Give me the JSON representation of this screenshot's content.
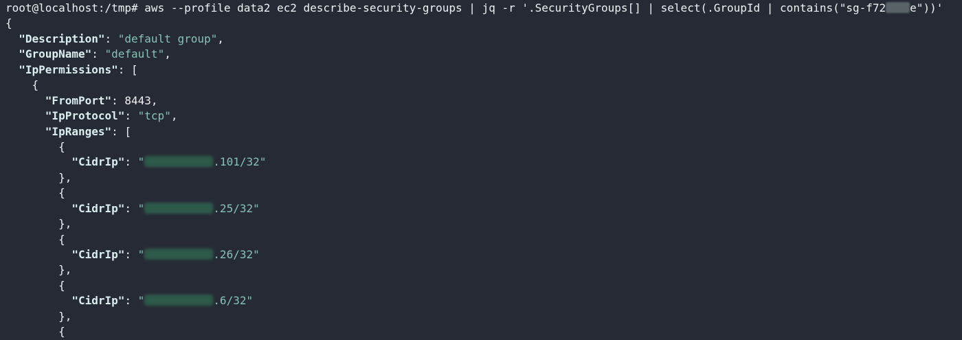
{
  "terminal": {
    "prompt": "root@localhost:/tmp# ",
    "command_before": "aws --profile data2 ec2 describe-security-groups | jq -r '.SecurityGroups[] | select(.GroupId | contains(\"sg-f72",
    "command_after": "e\"))'",
    "output": {
      "open_brace": "{",
      "description_key": "\"Description\"",
      "description_value": "\"default group\"",
      "groupname_key": "\"GroupName\"",
      "groupname_value": "\"default\"",
      "ippermissions_key": "\"IpPermissions\"",
      "fromport_key": "\"FromPort\"",
      "fromport_value": "8443",
      "ipprotocol_key": "\"IpProtocol\"",
      "ipprotocol_value": "\"tcp\"",
      "ipranges_key": "\"IpRanges\"",
      "cidr_key": "\"CidrIp\"",
      "cidr_ranges": [
        ".101/32\"",
        ".25/32\"",
        ".26/32\"",
        ".6/32\""
      ]
    }
  },
  "colors": {
    "background": "#262a35",
    "key": "#dcefef",
    "string": "#86c4b4"
  }
}
